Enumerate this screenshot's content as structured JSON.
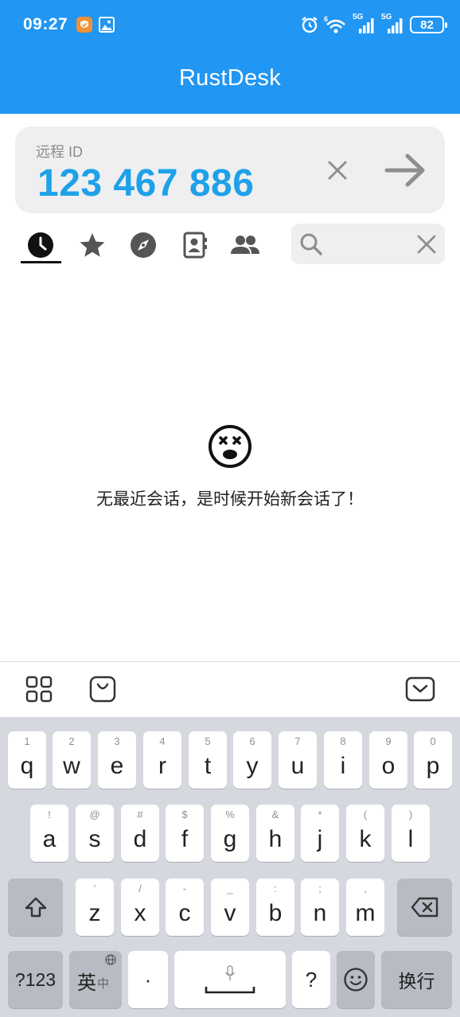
{
  "status_bar": {
    "time": "09:27",
    "network_a": "5G",
    "network_b": "5G",
    "battery": "82"
  },
  "app_bar": {
    "title": "RustDesk"
  },
  "remote_id": {
    "label": "远程 ID",
    "value": "123 467 886"
  },
  "tabs": [
    {
      "name": "recent",
      "icon": "clock-icon",
      "active": true
    },
    {
      "name": "favorites",
      "icon": "star-icon",
      "active": false
    },
    {
      "name": "discovered",
      "icon": "compass-icon",
      "active": false
    },
    {
      "name": "address-book",
      "icon": "contact-book-icon",
      "active": false
    },
    {
      "name": "group",
      "icon": "people-icon",
      "active": false
    }
  ],
  "search": {
    "value": "",
    "placeholder": ""
  },
  "empty_state": {
    "icon": "dizzy-face-icon",
    "message": "无最近会话，是时候开始新会话了！"
  },
  "keyboard": {
    "row1": [
      {
        "hint": "1",
        "key": "q"
      },
      {
        "hint": "2",
        "key": "w"
      },
      {
        "hint": "3",
        "key": "e"
      },
      {
        "hint": "4",
        "key": "r"
      },
      {
        "hint": "5",
        "key": "t"
      },
      {
        "hint": "6",
        "key": "y"
      },
      {
        "hint": "7",
        "key": "u"
      },
      {
        "hint": "8",
        "key": "i"
      },
      {
        "hint": "9",
        "key": "o"
      },
      {
        "hint": "0",
        "key": "p"
      }
    ],
    "row2": [
      {
        "hint": "!",
        "key": "a"
      },
      {
        "hint": "@",
        "key": "s"
      },
      {
        "hint": "#",
        "key": "d"
      },
      {
        "hint": "$",
        "key": "f"
      },
      {
        "hint": "%",
        "key": "g"
      },
      {
        "hint": "&",
        "key": "h"
      },
      {
        "hint": "*",
        "key": "j"
      },
      {
        "hint": "(",
        "key": "k"
      },
      {
        "hint": ")",
        "key": "l"
      }
    ],
    "row3": [
      {
        "hint": "'",
        "key": "z"
      },
      {
        "hint": "/",
        "key": "x"
      },
      {
        "hint": "-",
        "key": "c"
      },
      {
        "hint": "_",
        "key": "v"
      },
      {
        "hint": ":",
        "key": "b"
      },
      {
        "hint": ";",
        "key": "n"
      },
      {
        "hint": ",",
        "key": "m"
      }
    ],
    "symbols_key": "?123",
    "lang_key_main": "英",
    "lang_key_sub": "中",
    "dot_key": "·",
    "question_key": "?",
    "enter_key": "换行"
  },
  "colors": {
    "primary": "#2196f3",
    "id_text": "#1ea1e9",
    "card_bg": "#efeff1",
    "keyboard_bg": "#d5d8de"
  }
}
